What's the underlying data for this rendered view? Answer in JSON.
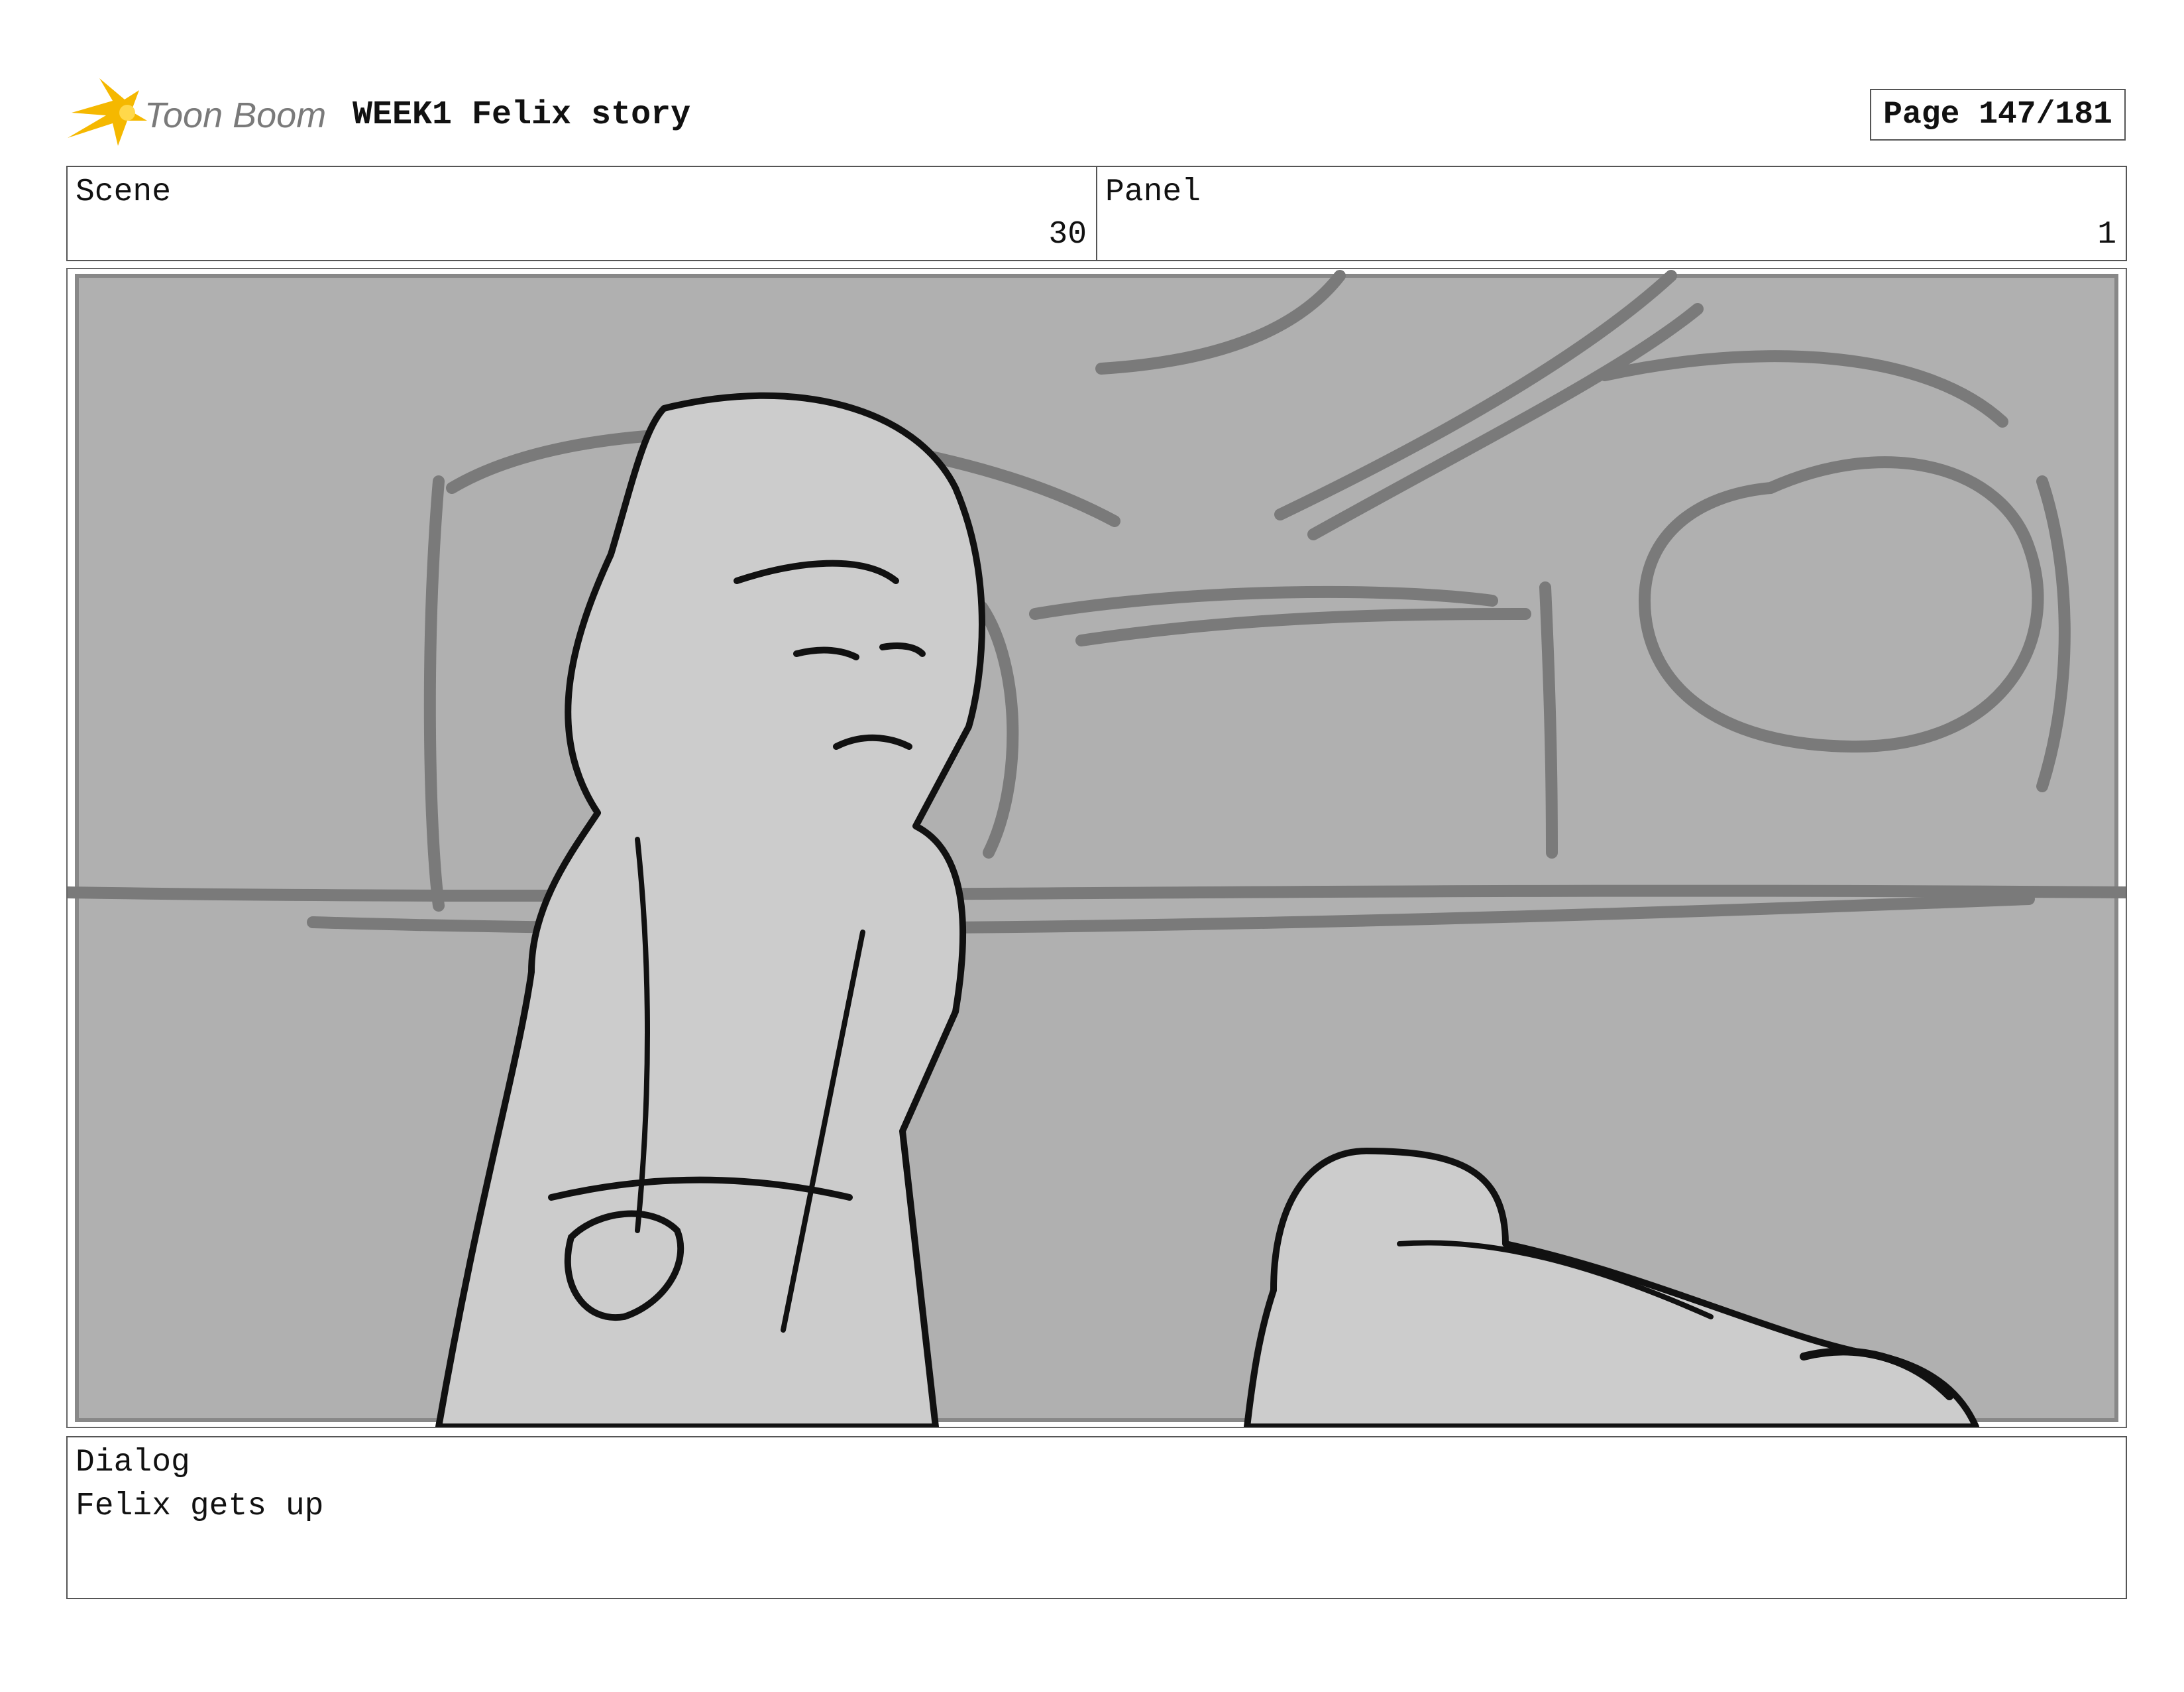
{
  "header": {
    "logo_text": "Toon Boom",
    "project_title": "WEEK1 Felix story",
    "page_label": "Page 147/181"
  },
  "info": {
    "scene_label": "Scene",
    "scene_value": "30",
    "panel_label": "Panel",
    "panel_value": "1"
  },
  "dialog": {
    "label": "Dialog",
    "text": "Felix gets up"
  },
  "colors": {
    "logo_star": "#f5b800",
    "logo_text": "#7a7a7a",
    "sketch_bg": "#b0b0b0",
    "sketch_fill": "#cccccc",
    "sketch_line": "#111111",
    "sketch_bg_line": "#7a7a7a"
  }
}
